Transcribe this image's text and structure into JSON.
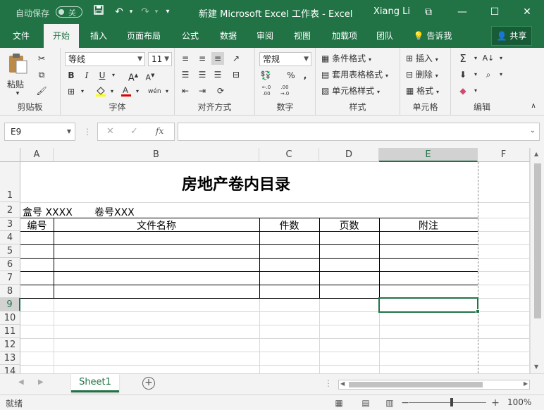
{
  "titlebar": {
    "autosave_label": "自动保存",
    "autosave_state": "关",
    "title": "新建 Microsoft Excel 工作表  -  Excel",
    "user": "Xiang Li",
    "save_glyph": "💾",
    "undo_glyph": "↶",
    "redo_glyph": "↷",
    "customize_glyph": "▾",
    "ribbon_options_glyph": "⧉",
    "minimize_glyph": "—",
    "maximize_glyph": "☐",
    "close_glyph": "✕"
  },
  "tabs": [
    "文件",
    "开始",
    "插入",
    "页面布局",
    "公式",
    "数据",
    "审阅",
    "视图",
    "加载项",
    "团队"
  ],
  "tellme": "告诉我",
  "share": "共享",
  "ribbon": {
    "clipboard": {
      "label": "剪贴板",
      "paste": "粘贴"
    },
    "font": {
      "label": "字体",
      "name": "等线",
      "size": "11",
      "bold": "B",
      "italic": "I",
      "underline": "U",
      "grow": "A",
      "shrink": "A",
      "wen": "wén"
    },
    "alignment": {
      "label": "对齐方式"
    },
    "number": {
      "label": "数字",
      "format": "常规",
      "percent": "%",
      "comma": ",",
      "inc": "←.0 .00",
      "dec": ".00 →.0"
    },
    "styles": {
      "label": "样式",
      "conditional": "条件格式",
      "table": "套用表格格式",
      "cell": "单元格样式"
    },
    "cells": {
      "label": "单元格",
      "insert": "插入",
      "delete": "删除",
      "format": "格式"
    },
    "editing": {
      "label": "编辑",
      "sum": "Σ"
    }
  },
  "formula_bar": {
    "name_box": "E9",
    "cancel": "✕",
    "enter": "✓",
    "fx": "fx",
    "value": ""
  },
  "grid": {
    "columns": [
      "A",
      "B",
      "C",
      "D",
      "E",
      "F"
    ],
    "rows": [
      "1",
      "2",
      "3",
      "4",
      "5",
      "6",
      "7",
      "8",
      "9",
      "10",
      "11",
      "12",
      "13",
      "14"
    ],
    "title": "房地产卷内目录",
    "row2_box": "盒号 XXXX",
    "row2_vol": "卷号XXX",
    "headers": [
      "编号",
      "文件名称",
      "件数",
      "页数",
      "附注"
    ]
  },
  "sheets": {
    "active": "Sheet1",
    "add": "+"
  },
  "status": {
    "ready": "就绪",
    "zoom": "100%"
  },
  "colors": {
    "accent": "#217346",
    "accent_dark": "#185c37"
  }
}
